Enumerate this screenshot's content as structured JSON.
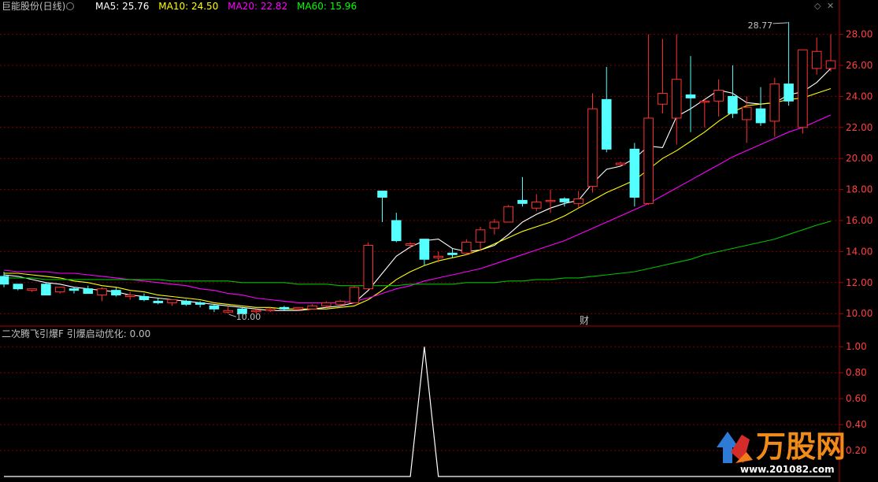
{
  "header": {
    "stock_title": "巨能股份(日线)",
    "ma_items": [
      {
        "label": "MA5: 25.76",
        "color": "#ffffff"
      },
      {
        "label": "MA10: 24.50",
        "color": "#ffff00"
      },
      {
        "label": "MA20: 22.82",
        "color": "#ff00ff"
      },
      {
        "label": "MA60: 15.96",
        "color": "#00ff00"
      }
    ],
    "diamond_icon": "diamond-icon",
    "close_icon": "close-icon"
  },
  "indicator": {
    "label": "二次腾飞引爆F  引爆启动优化: 0.00",
    "yticks": [
      "1.00",
      "0.80",
      "0.60",
      "0.40",
      "0.20"
    ]
  },
  "annotations": {
    "high_label": "28.77",
    "low_label": "10.00",
    "finance_marker": "财"
  },
  "watermark": {
    "brand": "万股网",
    "url": "www.201082.com"
  },
  "colors": {
    "up": "#ff3232",
    "down": "#54ffff",
    "ma5": "#ffffff",
    "ma10": "#ffff00",
    "ma20": "#ff00ff",
    "ma60": "#00c000",
    "grid": "#800000",
    "axis_text": "#ff4040"
  },
  "chart_data": [
    {
      "type": "candlestick",
      "title": "巨能股份(日线)",
      "yticks": [
        10,
        12,
        14,
        16,
        18,
        20,
        22,
        24,
        26,
        28
      ],
      "ylim": [
        9.3,
        29.4
      ],
      "grid": true,
      "candles": [
        [
          12.4,
          12.7,
          11.7,
          11.9
        ],
        [
          11.9,
          11.9,
          11.5,
          11.6
        ],
        [
          11.5,
          11.6,
          11.4,
          11.6
        ],
        [
          11.9,
          12.0,
          11.3,
          11.2
        ],
        [
          11.4,
          11.7,
          11.3,
          11.7
        ],
        [
          11.6,
          11.7,
          11.3,
          11.5
        ],
        [
          11.6,
          11.8,
          11.3,
          11.3
        ],
        [
          11.2,
          11.7,
          10.8,
          11.6
        ],
        [
          11.5,
          11.7,
          11.1,
          11.2
        ],
        [
          11.1,
          11.4,
          10.9,
          11.2
        ],
        [
          11.1,
          11.3,
          10.8,
          10.9
        ],
        [
          10.8,
          11.0,
          10.6,
          10.7
        ],
        [
          10.7,
          10.9,
          10.5,
          10.9
        ],
        [
          10.8,
          10.9,
          10.5,
          10.6
        ],
        [
          10.7,
          10.8,
          10.4,
          10.6
        ],
        [
          10.5,
          10.6,
          10.1,
          10.3
        ],
        [
          10.1,
          10.5,
          10.0,
          10.2
        ],
        [
          10.3,
          10.4,
          10.0,
          10.0
        ],
        [
          10.2,
          10.3,
          10.0,
          10.2
        ],
        [
          10.2,
          10.4,
          10.1,
          10.3
        ],
        [
          10.4,
          10.5,
          10.2,
          10.3
        ],
        [
          10.3,
          10.4,
          10.2,
          10.4
        ],
        [
          10.3,
          10.6,
          10.3,
          10.5
        ],
        [
          10.5,
          10.8,
          10.4,
          10.7
        ],
        [
          10.6,
          10.9,
          10.5,
          10.8
        ],
        [
          10.7,
          11.8,
          10.7,
          11.7
        ],
        [
          11.6,
          14.6,
          11.6,
          14.4
        ],
        [
          17.9,
          17.9,
          15.9,
          17.5
        ],
        [
          16.0,
          16.5,
          14.6,
          14.7
        ],
        [
          14.4,
          14.6,
          14.2,
          14.5
        ],
        [
          14.8,
          14.8,
          13.1,
          13.5
        ],
        [
          13.6,
          14.0,
          13.3,
          13.7
        ],
        [
          13.9,
          14.2,
          13.6,
          13.8
        ],
        [
          13.9,
          14.8,
          13.8,
          14.6
        ],
        [
          14.6,
          15.6,
          14.1,
          15.4
        ],
        [
          15.5,
          16.1,
          15.1,
          15.9
        ],
        [
          15.9,
          17.0,
          15.9,
          16.9
        ],
        [
          17.3,
          18.8,
          16.9,
          17.1
        ],
        [
          16.8,
          17.7,
          16.6,
          17.2
        ],
        [
          17.3,
          18.0,
          16.5,
          17.3
        ],
        [
          17.4,
          17.5,
          16.9,
          17.2
        ],
        [
          17.1,
          17.9,
          16.8,
          17.4
        ],
        [
          18.2,
          24.2,
          17.8,
          23.2
        ],
        [
          23.8,
          25.9,
          20.4,
          20.6
        ],
        [
          19.6,
          19.8,
          19.5,
          19.7
        ],
        [
          20.6,
          21.0,
          16.9,
          17.5
        ],
        [
          17.1,
          28.0,
          17.0,
          22.6
        ],
        [
          23.5,
          27.7,
          22.9,
          24.2
        ],
        [
          22.6,
          28.0,
          20.9,
          25.1
        ],
        [
          24.1,
          26.6,
          21.7,
          23.9
        ],
        [
          23.7,
          23.8,
          22.0,
          23.7
        ],
        [
          23.7,
          25.1,
          22.7,
          24.4
        ],
        [
          24.0,
          26.0,
          22.6,
          22.9
        ],
        [
          22.5,
          24.0,
          21.0,
          23.3
        ],
        [
          23.2,
          24.6,
          22.1,
          22.3
        ],
        [
          22.4,
          25.2,
          21.4,
          24.8
        ],
        [
          24.8,
          28.8,
          23.4,
          23.7
        ],
        [
          22.0,
          27.0,
          21.6,
          27.0
        ],
        [
          25.8,
          27.8,
          25.4,
          26.9
        ],
        [
          25.8,
          28.0,
          25.6,
          26.3
        ]
      ],
      "series": [
        {
          "name": "MA5",
          "values": [
            12.5,
            12.4,
            12.2,
            12.0,
            11.9,
            11.7,
            11.6,
            11.5,
            11.4,
            11.2,
            11.1,
            11.0,
            10.9,
            10.8,
            10.7,
            10.6,
            10.5,
            10.4,
            10.3,
            10.2,
            10.2,
            10.2,
            10.3,
            10.4,
            10.5,
            10.7,
            11.5,
            12.6,
            13.7,
            14.3,
            14.7,
            14.8,
            14.2,
            14.0,
            14.1,
            14.4,
            15.1,
            15.9,
            16.4,
            16.8,
            17.1,
            17.3,
            18.4,
            19.3,
            19.5,
            20.0,
            20.8,
            20.7,
            22.7,
            23.2,
            23.8,
            24.4,
            24.2,
            23.6,
            23.5,
            23.6,
            24.1,
            24.3,
            24.9,
            25.8
          ]
        },
        {
          "name": "MA10",
          "values": [
            12.6,
            12.6,
            12.5,
            12.4,
            12.3,
            12.1,
            12.0,
            11.8,
            11.7,
            11.5,
            11.4,
            11.2,
            11.1,
            11.0,
            10.9,
            10.7,
            10.6,
            10.5,
            10.4,
            10.4,
            10.3,
            10.3,
            10.3,
            10.3,
            10.4,
            10.5,
            10.9,
            11.5,
            12.2,
            12.7,
            13.1,
            13.4,
            13.6,
            13.8,
            14.1,
            14.5,
            14.9,
            15.3,
            15.6,
            15.9,
            16.3,
            16.8,
            17.3,
            17.8,
            18.2,
            18.6,
            19.3,
            20.0,
            20.5,
            21.1,
            21.7,
            22.4,
            23.0,
            23.4,
            23.5,
            23.6,
            23.8,
            23.9,
            24.2,
            24.5
          ]
        },
        {
          "name": "MA20",
          "values": [
            12.8,
            12.7,
            12.7,
            12.7,
            12.6,
            12.6,
            12.5,
            12.4,
            12.3,
            12.2,
            12.1,
            12.0,
            11.9,
            11.8,
            11.6,
            11.5,
            11.3,
            11.2,
            11.0,
            10.9,
            10.8,
            10.7,
            10.7,
            10.7,
            10.7,
            10.8,
            11.0,
            11.3,
            11.6,
            11.8,
            12.1,
            12.3,
            12.5,
            12.7,
            12.9,
            13.2,
            13.5,
            13.8,
            14.1,
            14.4,
            14.7,
            15.1,
            15.5,
            15.9,
            16.3,
            16.7,
            17.1,
            17.6,
            18.1,
            18.6,
            19.1,
            19.6,
            20.1,
            20.5,
            20.9,
            21.3,
            21.7,
            22.0,
            22.4,
            22.8
          ]
        },
        {
          "name": "MA60",
          "values": [
            12.3,
            12.3,
            12.3,
            12.2,
            12.2,
            12.2,
            12.2,
            12.2,
            12.2,
            12.2,
            12.2,
            12.2,
            12.1,
            12.1,
            12.1,
            12.1,
            12.1,
            12.0,
            12.0,
            12.0,
            12.0,
            11.9,
            11.9,
            11.9,
            11.8,
            11.8,
            11.8,
            11.8,
            11.8,
            11.9,
            11.9,
            11.9,
            11.9,
            12.0,
            12.0,
            12.0,
            12.1,
            12.1,
            12.2,
            12.2,
            12.3,
            12.3,
            12.4,
            12.5,
            12.6,
            12.7,
            12.9,
            13.1,
            13.3,
            13.5,
            13.8,
            14.0,
            14.2,
            14.4,
            14.6,
            14.8,
            15.1,
            15.4,
            15.7,
            15.96
          ]
        }
      ]
    },
    {
      "type": "line",
      "title": "二次腾飞引爆F  引爆启动优化: 0.00",
      "yticks": [
        1.0,
        0.8,
        0.6,
        0.4,
        0.2
      ],
      "ylim": [
        0,
        1.05
      ],
      "series": [
        {
          "name": "引爆启动优化",
          "values": [
            0,
            0,
            0,
            0,
            0,
            0,
            0,
            0,
            0,
            0,
            0,
            0,
            0,
            0,
            0,
            0,
            0,
            0,
            0,
            0,
            0,
            0,
            0,
            0,
            0,
            0,
            0,
            0,
            0,
            0,
            1,
            0,
            0,
            0,
            0,
            0,
            0,
            0,
            0,
            0,
            0,
            0,
            0,
            0,
            0,
            0,
            0,
            0,
            0,
            0,
            0,
            0,
            0,
            0,
            0,
            0,
            0,
            0,
            0,
            0
          ]
        }
      ]
    }
  ]
}
